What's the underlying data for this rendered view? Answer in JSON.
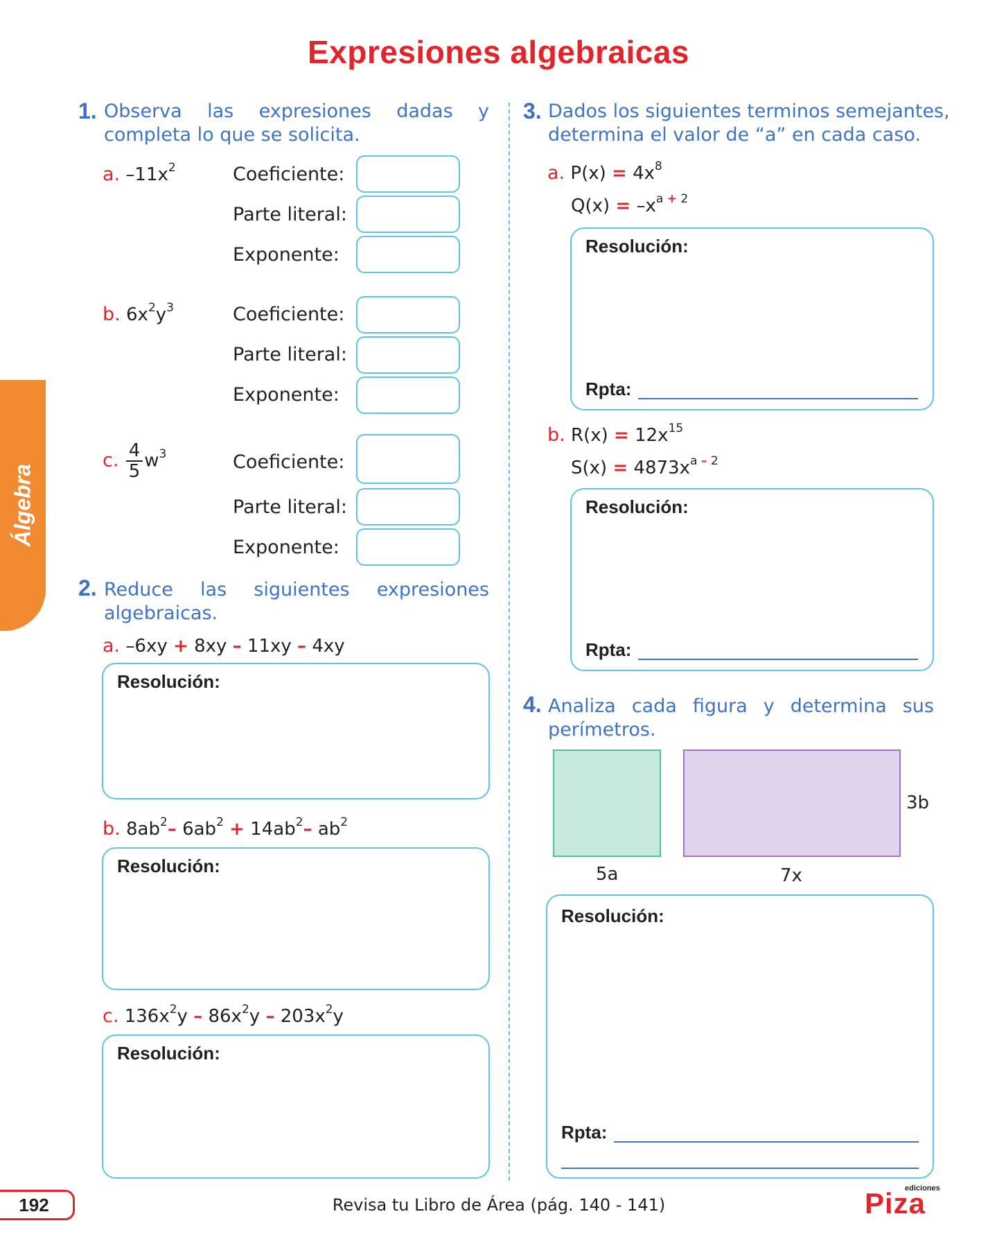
{
  "title": "Expresiones algebraicas",
  "side_tab": "Álgebra",
  "q1": {
    "number": "1.",
    "text_line1": [
      "Observa",
      "las",
      "expresiones",
      "dadas",
      "y"
    ],
    "text_line2": "completa lo que se solicita.",
    "items": [
      {
        "letter": "a.",
        "coef": "–11x",
        "exp": "2"
      },
      {
        "letter": "b.",
        "coef": "6x",
        "exp": "2",
        "mid": "y",
        "exp2": "3"
      },
      {
        "letter": "c.",
        "num": "4",
        "den": "5",
        "var": "w",
        "exp": "3"
      }
    ],
    "labels": {
      "coef": "Coeficiente:",
      "literal": "Parte literal:",
      "exponent": "Exponente:"
    }
  },
  "q2": {
    "number": "2.",
    "text_line1": [
      "Reduce",
      "las",
      "siguientes",
      "expresiones"
    ],
    "text_line2": "algebraicas.",
    "a": {
      "letter": "a.",
      "t1": "–6xy",
      "op1": "+",
      "t2": "8xy",
      "op2": "–",
      "t3": "11xy",
      "op3": "–",
      "t4": "4xy"
    },
    "b": {
      "letter": "b.",
      "t1": "8ab",
      "op1": "–",
      "t2": "6ab",
      "op2": "+",
      "t3": "14ab",
      "op3": "–",
      "t4": "ab",
      "exp": "2"
    },
    "c": {
      "letter": "c.",
      "t1": "136x",
      "t1b": "y",
      "op1": "–",
      "t2": "86x",
      "t2b": "y",
      "op2": "–",
      "t3": "203x",
      "t3b": "y",
      "exp": "2"
    }
  },
  "q3": {
    "number": "3.",
    "text_line1": "Dados los siguientes terminos semejantes,",
    "text_line2": "determina el valor de “a” en cada caso.",
    "a": {
      "letter": "a.",
      "p_name": "P(x)",
      "eq": "=",
      "p_val": "4x",
      "p_exp": "8",
      "q_name": "Q(x)",
      "q_val": "–x",
      "q_exp_a": "a",
      "q_exp_op": "+",
      "q_exp_n": "2"
    },
    "b": {
      "letter": "b.",
      "r_name": "R(x)",
      "eq": "=",
      "r_val": "12x",
      "r_exp": "15",
      "s_name": "S(x)",
      "s_val": "4873x",
      "s_exp_a": "a",
      "s_exp_op": "–",
      "s_exp_n": "2"
    }
  },
  "q4": {
    "number": "4.",
    "text_line1": [
      "Analiza",
      "cada",
      "figura",
      "y",
      "determina",
      "sus"
    ],
    "text_line2": "perímetros.",
    "square_label": "5a",
    "rect_width_label": "7x",
    "rect_height_label": "3b",
    "square_color": "#c8eadd",
    "rect_color": "#e0d3ec"
  },
  "resolution_label": "Resolución:",
  "answer_label": "Rpta:",
  "page_number": "192",
  "footer": "Revisa tu Libro de Área (pág. 140 - 141)",
  "logo": "Piza",
  "logo_small": "ediciones"
}
